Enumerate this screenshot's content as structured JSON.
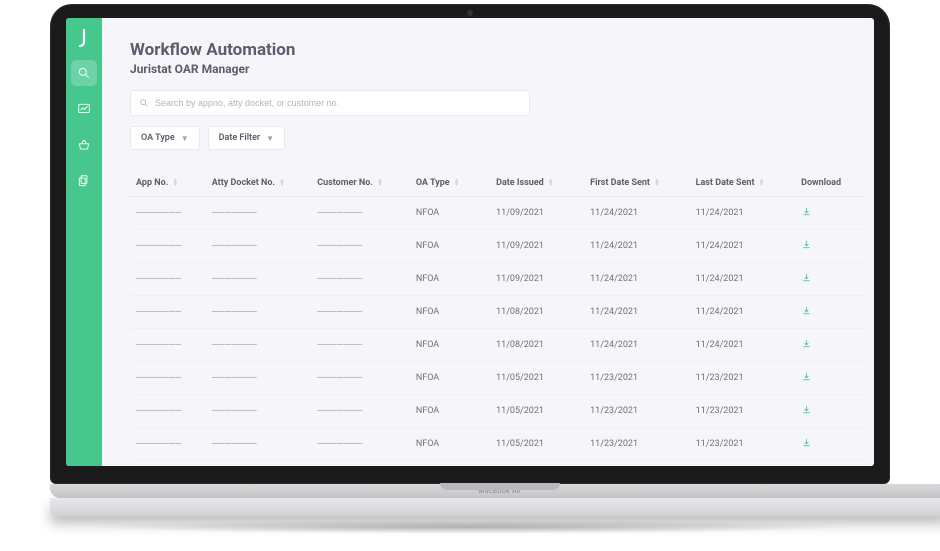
{
  "header": {
    "title": "Workflow Automation",
    "subtitle": "Juristat OAR Manager"
  },
  "search": {
    "placeholder": "Search by appno, atty docket, or customer no."
  },
  "filters": {
    "oa_type": "OA Type",
    "date_filter": "Date Filter"
  },
  "laptop_label": "MacBook Air",
  "table": {
    "columns": {
      "app_no": "App No.",
      "atty_docket": "Atty Docket No.",
      "customer_no": "Customer No.",
      "oa_type": "OA Type",
      "date_issued": "Date Issued",
      "first_date_sent": "First Date Sent",
      "last_date_sent": "Last Date Sent",
      "download": "Download"
    },
    "rows": [
      {
        "app_no": "———————",
        "atty_docket": "———————",
        "customer_no": "———————",
        "oa_type": "NFOA",
        "date_issued": "11/09/2021",
        "first_sent": "11/24/2021",
        "last_sent": "11/24/2021"
      },
      {
        "app_no": "———————",
        "atty_docket": "———————",
        "customer_no": "———————",
        "oa_type": "NFOA",
        "date_issued": "11/09/2021",
        "first_sent": "11/24/2021",
        "last_sent": "11/24/2021"
      },
      {
        "app_no": "———————",
        "atty_docket": "———————",
        "customer_no": "———————",
        "oa_type": "NFOA",
        "date_issued": "11/09/2021",
        "first_sent": "11/24/2021",
        "last_sent": "11/24/2021"
      },
      {
        "app_no": "———————",
        "atty_docket": "———————",
        "customer_no": "———————",
        "oa_type": "NFOA",
        "date_issued": "11/08/2021",
        "first_sent": "11/24/2021",
        "last_sent": "11/24/2021"
      },
      {
        "app_no": "———————",
        "atty_docket": "———————",
        "customer_no": "———————",
        "oa_type": "NFOA",
        "date_issued": "11/08/2021",
        "first_sent": "11/24/2021",
        "last_sent": "11/24/2021"
      },
      {
        "app_no": "———————",
        "atty_docket": "———————",
        "customer_no": "———————",
        "oa_type": "NFOA",
        "date_issued": "11/05/2021",
        "first_sent": "11/23/2021",
        "last_sent": "11/23/2021"
      },
      {
        "app_no": "———————",
        "atty_docket": "———————",
        "customer_no": "———————",
        "oa_type": "NFOA",
        "date_issued": "11/05/2021",
        "first_sent": "11/23/2021",
        "last_sent": "11/23/2021"
      },
      {
        "app_no": "———————",
        "atty_docket": "———————",
        "customer_no": "———————",
        "oa_type": "NFOA",
        "date_issued": "11/05/2021",
        "first_sent": "11/23/2021",
        "last_sent": "11/23/2021"
      }
    ]
  }
}
